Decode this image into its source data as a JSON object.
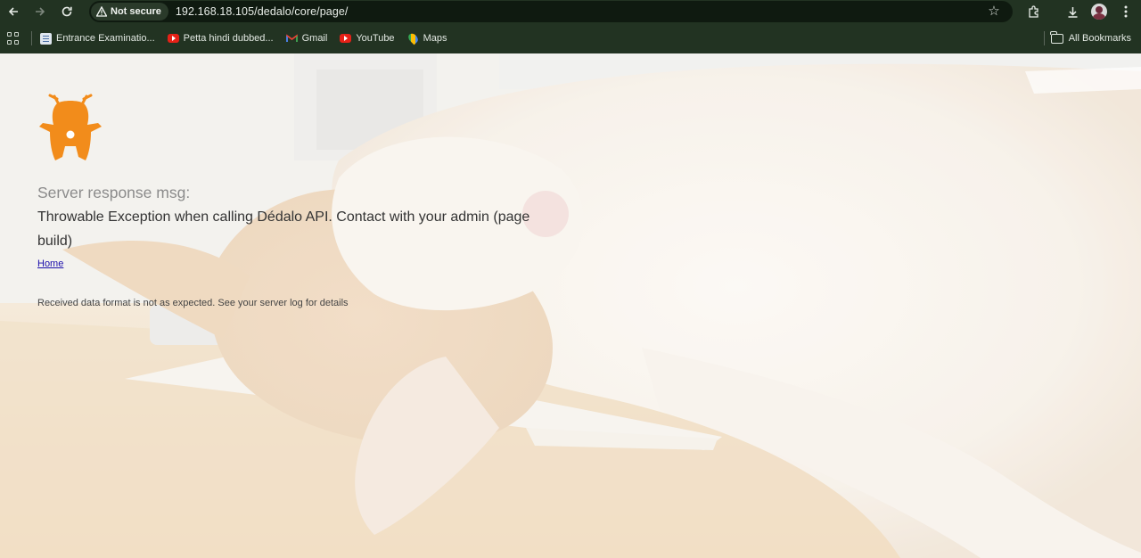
{
  "browser": {
    "security_label": "Not secure",
    "url": "192.168.18.105/dedalo/core/page/",
    "bookmarks": [
      {
        "label": "Entrance Examinatio...",
        "icon": "document-icon"
      },
      {
        "label": "Petta hindi dubbed...",
        "icon": "youtube-icon"
      },
      {
        "label": "Gmail",
        "icon": "gmail-icon"
      },
      {
        "label": "YouTube",
        "icon": "youtube-icon"
      },
      {
        "label": "Maps",
        "icon": "maps-icon"
      }
    ],
    "all_bookmarks_label": "All Bookmarks"
  },
  "page": {
    "response_title": "Server response msg:",
    "response_message": "Throwable Exception when calling Dédalo API. Contact with your admin (page build)",
    "home_link": "Home",
    "detail_text": "Received data format is not as expected. See your server log for details"
  },
  "colors": {
    "chrome_bg": "#223322",
    "logo_orange": "#f28c1b",
    "link": "#1a0dab"
  }
}
